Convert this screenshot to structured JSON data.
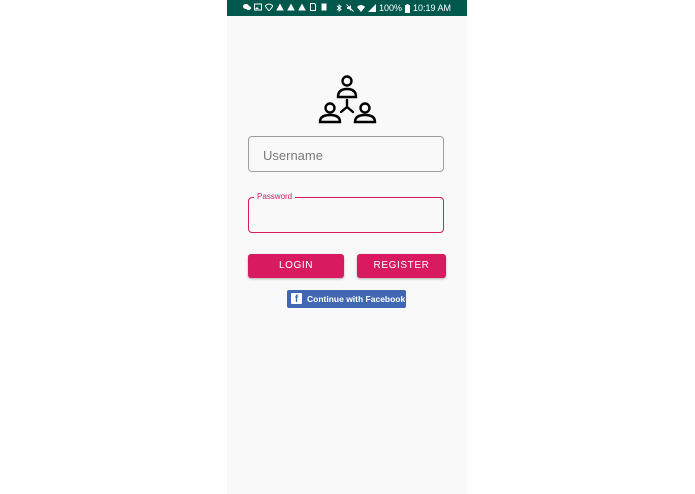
{
  "status_bar": {
    "battery": "100%",
    "time": "10:19 AM",
    "left_icons": [
      "chat-icon",
      "image-icon",
      "wifi-icon",
      "warning-icon",
      "warning-icon",
      "warning-icon",
      "sim-icon",
      "storage-icon"
    ],
    "right_icons": [
      "bluetooth-icon",
      "mute-icon",
      "wifi-icon",
      "signal-icon",
      "battery-icon"
    ],
    "background": "#00574b"
  },
  "logo": {
    "icon": "people-network-icon"
  },
  "form": {
    "username_placeholder": "Username",
    "password_label": "Password",
    "password_value": ""
  },
  "buttons": {
    "login_label": "LOGIN",
    "register_label": "REGISTER",
    "facebook_label": "Continue with Facebook",
    "facebook_icon": "facebook-icon"
  },
  "colors": {
    "accent": "#d81b60",
    "facebook": "#4267b2",
    "background": "#f9f9f9"
  }
}
